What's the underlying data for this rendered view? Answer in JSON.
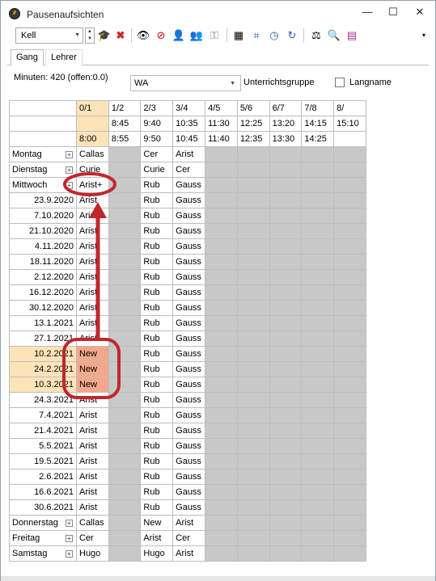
{
  "window": {
    "title": "Pausenaufsichten",
    "min": "—",
    "max": "☐",
    "close": "✕"
  },
  "toolbar": {
    "teacher_value": "Kell"
  },
  "tabs": [
    {
      "label": "Gang"
    },
    {
      "label": "Lehrer"
    }
  ],
  "filter": {
    "minutes_text": "Minuten: 420 (offen:0.0)",
    "group_value": "WA",
    "group_label": "Unterrichtsgruppe",
    "longname_label": "Langname"
  },
  "columns": [
    {
      "label": "0/1",
      "t1": "",
      "t2": "8:00"
    },
    {
      "label": "1/2",
      "t1": "8:45",
      "t2": "8:55"
    },
    {
      "label": "2/3",
      "t1": "9:40",
      "t2": "9:50"
    },
    {
      "label": "3/4",
      "t1": "10:35",
      "t2": "10:45"
    },
    {
      "label": "4/5",
      "t1": "11:30",
      "t2": "11:40"
    },
    {
      "label": "5/6",
      "t1": "12:25",
      "t2": "12:35"
    },
    {
      "label": "6/7",
      "t1": "13:20",
      "t2": "13:30"
    },
    {
      "label": "7/8",
      "t1": "14:15",
      "t2": "14:25"
    },
    {
      "label": "8/",
      "t1": "15:10",
      "t2": ""
    }
  ],
  "rows": [
    {
      "label": "Montag",
      "day": true,
      "c0": "Callas",
      "c2": "Cer",
      "c3": "Arist"
    },
    {
      "label": "Dienstag",
      "day": true,
      "c0": "Curie",
      "c2": "Curie",
      "c3": "Cer"
    },
    {
      "label": "Mittwoch",
      "day": true,
      "c0": "Arist+",
      "c2": "Rub",
      "c3": "Gauss"
    },
    {
      "label": "23.9.2020",
      "c0": "Arist",
      "c2": "Rub",
      "c3": "Gauss"
    },
    {
      "label": "7.10.2020",
      "c0": "Arist",
      "c2": "Rub",
      "c3": "Gauss"
    },
    {
      "label": "21.10.2020",
      "c0": "Arist",
      "c2": "Rub",
      "c3": "Gauss"
    },
    {
      "label": "4.11.2020",
      "c0": "Arist",
      "c2": "Rub",
      "c3": "Gauss"
    },
    {
      "label": "18.11.2020",
      "c0": "Arist",
      "c2": "Rub",
      "c3": "Gauss"
    },
    {
      "label": "2.12.2020",
      "c0": "Arist",
      "c2": "Rub",
      "c3": "Gauss"
    },
    {
      "label": "16.12.2020",
      "c0": "Arist",
      "c2": "Rub",
      "c3": "Gauss"
    },
    {
      "label": "30.12.2020",
      "c0": "Arist",
      "c2": "Rub",
      "c3": "Gauss"
    },
    {
      "label": "13.1.2021",
      "c0": "Arist",
      "c2": "Rub",
      "c3": "Gauss"
    },
    {
      "label": "27.1.2021",
      "c0": "Arist",
      "c2": "Rub",
      "c3": "Gauss"
    },
    {
      "label": "10.2.2021",
      "hl": true,
      "c0": "New",
      "new": true,
      "c2": "Rub",
      "c3": "Gauss"
    },
    {
      "label": "24.2.2021",
      "hl": true,
      "c0": "New",
      "new": true,
      "c2": "Rub",
      "c3": "Gauss"
    },
    {
      "label": "10.3.2021",
      "hl": true,
      "c0": "New",
      "new": true,
      "c2": "Rub",
      "c3": "Gauss"
    },
    {
      "label": "24.3.2021",
      "c0": "Arist",
      "c2": "Rub",
      "c3": "Gauss"
    },
    {
      "label": "7.4.2021",
      "c0": "Arist",
      "c2": "Rub",
      "c3": "Gauss"
    },
    {
      "label": "21.4.2021",
      "c0": "Arist",
      "c2": "Rub",
      "c3": "Gauss"
    },
    {
      "label": "5.5.2021",
      "c0": "Arist",
      "c2": "Rub",
      "c3": "Gauss"
    },
    {
      "label": "19.5.2021",
      "c0": "Arist",
      "c2": "Rub",
      "c3": "Gauss"
    },
    {
      "label": "2.6.2021",
      "c0": "Arist",
      "c2": "Rub",
      "c3": "Gauss"
    },
    {
      "label": "16.6.2021",
      "c0": "Arist",
      "c2": "Rub",
      "c3": "Gauss"
    },
    {
      "label": "30.6.2021",
      "c0": "Arist",
      "c2": "Rub",
      "c3": "Gauss"
    },
    {
      "label": "Donnerstag",
      "day": true,
      "c0": "Callas",
      "c2": "New",
      "c3": "Arist"
    },
    {
      "label": "Freitag",
      "day": true,
      "c0": "Cer",
      "c2": "Arist",
      "c3": "Cer"
    },
    {
      "label": "Samstag",
      "day": true,
      "c0": "Hugo",
      "c2": "Hugo",
      "c3": "Arist"
    }
  ],
  "colors": {
    "accent_highlight": "#fde3b8",
    "new_cell": "#f2a98a",
    "annotation": "#c0272d",
    "grey_cell": "#c8c8c8"
  }
}
